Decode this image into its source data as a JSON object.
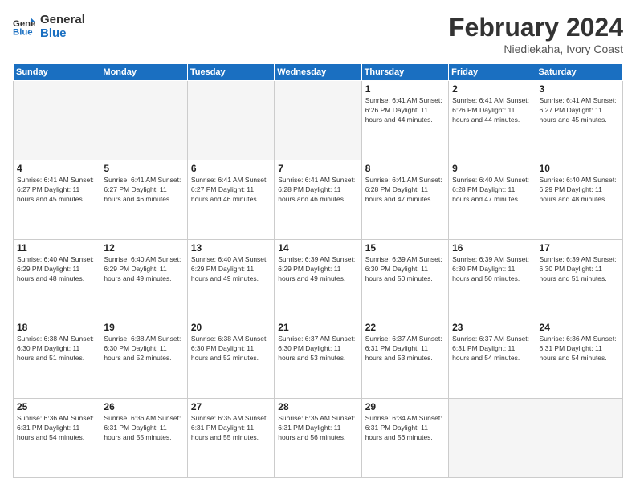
{
  "header": {
    "logo_line1": "General",
    "logo_line2": "Blue",
    "month": "February 2024",
    "location": "Niediekaha, Ivory Coast"
  },
  "weekdays": [
    "Sunday",
    "Monday",
    "Tuesday",
    "Wednesday",
    "Thursday",
    "Friday",
    "Saturday"
  ],
  "weeks": [
    [
      {
        "day": "",
        "info": ""
      },
      {
        "day": "",
        "info": ""
      },
      {
        "day": "",
        "info": ""
      },
      {
        "day": "",
        "info": ""
      },
      {
        "day": "1",
        "info": "Sunrise: 6:41 AM\nSunset: 6:26 PM\nDaylight: 11 hours\nand 44 minutes."
      },
      {
        "day": "2",
        "info": "Sunrise: 6:41 AM\nSunset: 6:26 PM\nDaylight: 11 hours\nand 44 minutes."
      },
      {
        "day": "3",
        "info": "Sunrise: 6:41 AM\nSunset: 6:27 PM\nDaylight: 11 hours\nand 45 minutes."
      }
    ],
    [
      {
        "day": "4",
        "info": "Sunrise: 6:41 AM\nSunset: 6:27 PM\nDaylight: 11 hours\nand 45 minutes."
      },
      {
        "day": "5",
        "info": "Sunrise: 6:41 AM\nSunset: 6:27 PM\nDaylight: 11 hours\nand 46 minutes."
      },
      {
        "day": "6",
        "info": "Sunrise: 6:41 AM\nSunset: 6:27 PM\nDaylight: 11 hours\nand 46 minutes."
      },
      {
        "day": "7",
        "info": "Sunrise: 6:41 AM\nSunset: 6:28 PM\nDaylight: 11 hours\nand 46 minutes."
      },
      {
        "day": "8",
        "info": "Sunrise: 6:41 AM\nSunset: 6:28 PM\nDaylight: 11 hours\nand 47 minutes."
      },
      {
        "day": "9",
        "info": "Sunrise: 6:40 AM\nSunset: 6:28 PM\nDaylight: 11 hours\nand 47 minutes."
      },
      {
        "day": "10",
        "info": "Sunrise: 6:40 AM\nSunset: 6:29 PM\nDaylight: 11 hours\nand 48 minutes."
      }
    ],
    [
      {
        "day": "11",
        "info": "Sunrise: 6:40 AM\nSunset: 6:29 PM\nDaylight: 11 hours\nand 48 minutes."
      },
      {
        "day": "12",
        "info": "Sunrise: 6:40 AM\nSunset: 6:29 PM\nDaylight: 11 hours\nand 49 minutes."
      },
      {
        "day": "13",
        "info": "Sunrise: 6:40 AM\nSunset: 6:29 PM\nDaylight: 11 hours\nand 49 minutes."
      },
      {
        "day": "14",
        "info": "Sunrise: 6:39 AM\nSunset: 6:29 PM\nDaylight: 11 hours\nand 49 minutes."
      },
      {
        "day": "15",
        "info": "Sunrise: 6:39 AM\nSunset: 6:30 PM\nDaylight: 11 hours\nand 50 minutes."
      },
      {
        "day": "16",
        "info": "Sunrise: 6:39 AM\nSunset: 6:30 PM\nDaylight: 11 hours\nand 50 minutes."
      },
      {
        "day": "17",
        "info": "Sunrise: 6:39 AM\nSunset: 6:30 PM\nDaylight: 11 hours\nand 51 minutes."
      }
    ],
    [
      {
        "day": "18",
        "info": "Sunrise: 6:38 AM\nSunset: 6:30 PM\nDaylight: 11 hours\nand 51 minutes."
      },
      {
        "day": "19",
        "info": "Sunrise: 6:38 AM\nSunset: 6:30 PM\nDaylight: 11 hours\nand 52 minutes."
      },
      {
        "day": "20",
        "info": "Sunrise: 6:38 AM\nSunset: 6:30 PM\nDaylight: 11 hours\nand 52 minutes."
      },
      {
        "day": "21",
        "info": "Sunrise: 6:37 AM\nSunset: 6:30 PM\nDaylight: 11 hours\nand 53 minutes."
      },
      {
        "day": "22",
        "info": "Sunrise: 6:37 AM\nSunset: 6:31 PM\nDaylight: 11 hours\nand 53 minutes."
      },
      {
        "day": "23",
        "info": "Sunrise: 6:37 AM\nSunset: 6:31 PM\nDaylight: 11 hours\nand 54 minutes."
      },
      {
        "day": "24",
        "info": "Sunrise: 6:36 AM\nSunset: 6:31 PM\nDaylight: 11 hours\nand 54 minutes."
      }
    ],
    [
      {
        "day": "25",
        "info": "Sunrise: 6:36 AM\nSunset: 6:31 PM\nDaylight: 11 hours\nand 54 minutes."
      },
      {
        "day": "26",
        "info": "Sunrise: 6:36 AM\nSunset: 6:31 PM\nDaylight: 11 hours\nand 55 minutes."
      },
      {
        "day": "27",
        "info": "Sunrise: 6:35 AM\nSunset: 6:31 PM\nDaylight: 11 hours\nand 55 minutes."
      },
      {
        "day": "28",
        "info": "Sunrise: 6:35 AM\nSunset: 6:31 PM\nDaylight: 11 hours\nand 56 minutes."
      },
      {
        "day": "29",
        "info": "Sunrise: 6:34 AM\nSunset: 6:31 PM\nDaylight: 11 hours\nand 56 minutes."
      },
      {
        "day": "",
        "info": ""
      },
      {
        "day": "",
        "info": ""
      }
    ]
  ]
}
